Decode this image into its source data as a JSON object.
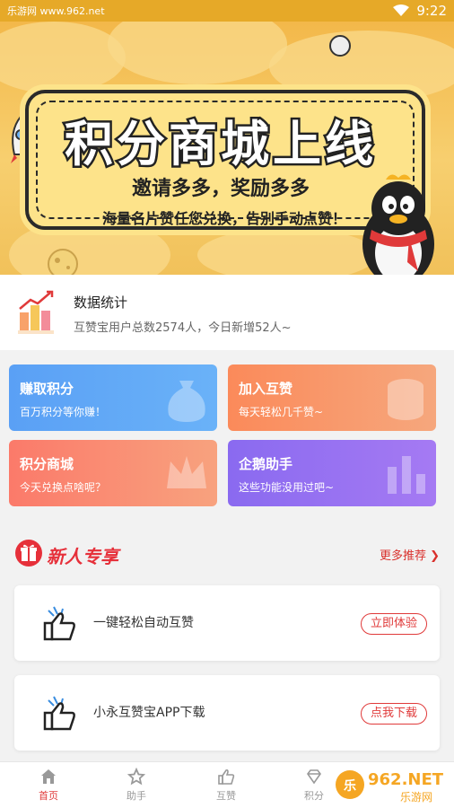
{
  "status_bar": {
    "left_text": "乐游网 www.962.net",
    "time": "9:22"
  },
  "banner": {
    "title": "积分商城上线",
    "subtitle": "邀请多多，奖励多多",
    "subtitle2": "海量名片赞任您兑换，告别手动点赞！",
    "page_count": 5,
    "active_page": 2
  },
  "stats": {
    "title": "数据统计",
    "desc": "互赞宝用户总数2574人，今日新增52人~"
  },
  "cards": [
    {
      "title": "赚取积分",
      "desc": "百万积分等你赚！"
    },
    {
      "title": "加入互赞",
      "desc": "每天轻松几千赞~"
    },
    {
      "title": "积分商城",
      "desc": "今天兑换点啥呢？"
    },
    {
      "title": "企鹅助手",
      "desc": "这些功能没用过吧~"
    }
  ],
  "section": {
    "title": "新人专享",
    "more": "更多推荐 ❯"
  },
  "tasks": [
    {
      "label": "一键轻松自动互赞",
      "button": "立即体验"
    },
    {
      "label": "小永互赞宝APP下载",
      "button": "点我下载"
    }
  ],
  "nav": [
    {
      "label": "首页",
      "icon": "home-icon"
    },
    {
      "label": "助手",
      "icon": "star-icon"
    },
    {
      "label": "互赞",
      "icon": "thumb-icon"
    },
    {
      "label": "积分",
      "icon": "diamond-icon"
    }
  ],
  "watermark": {
    "text": "962.NET",
    "subtext": "乐游网"
  },
  "colors": {
    "accent": "#e03a3a",
    "banner": "#f6c75a"
  }
}
